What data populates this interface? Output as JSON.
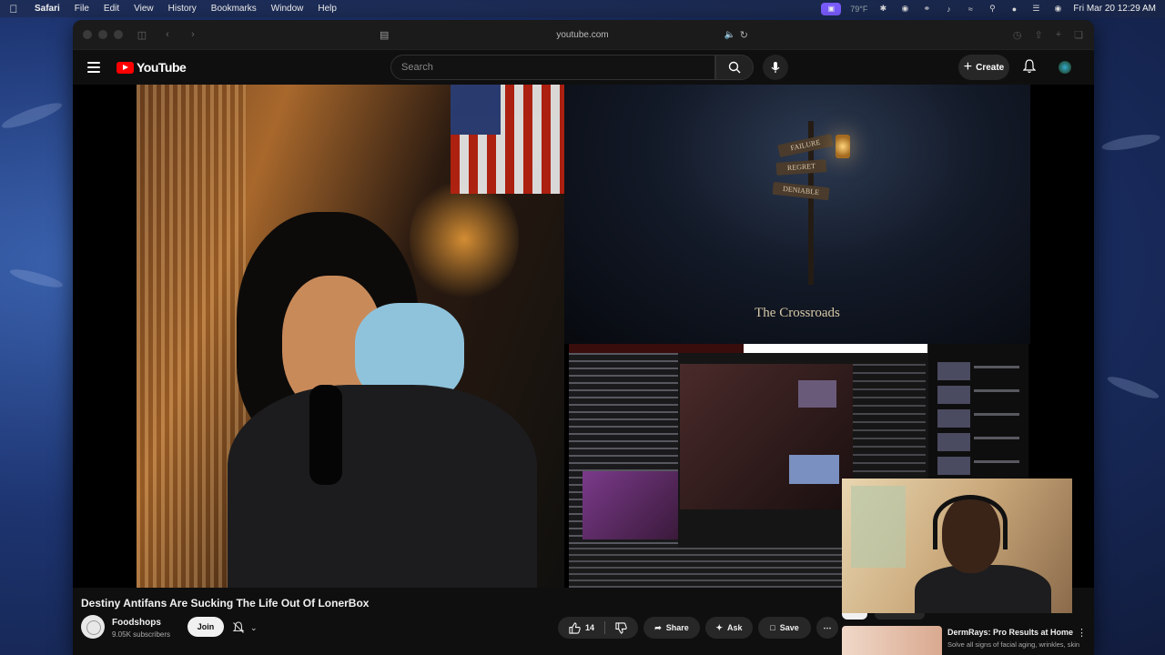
{
  "menubar": {
    "app": "Safari",
    "items": [
      "File",
      "Edit",
      "View",
      "History",
      "Bookmarks",
      "Window",
      "Help"
    ],
    "weather": "79°F",
    "datetime": "Fri Mar 20  12:29 AM"
  },
  "browser": {
    "url": "youtube.com"
  },
  "youtube": {
    "logo": "YouTube",
    "search_placeholder": "Search",
    "create_label": "Create"
  },
  "player": {
    "overlay_caption": "The Crossroads",
    "sign_words": [
      "FAILURE",
      "REGRET",
      "DENIABLE"
    ]
  },
  "video": {
    "title": "Destiny Antifans Are Sucking The Life Out Of LonerBox",
    "channel": "Foodshops",
    "subscribers": "9.05K subscribers",
    "join_label": "Join",
    "likes": "14",
    "share_label": "Share",
    "ask_label": "Ask",
    "save_label": "Save"
  },
  "chips": [
    "All",
    "From Foo"
  ],
  "ad": {
    "title": "DermRays: Pro Results at Home",
    "description": "Solve all signs of facial aging, wrinkles, skin elasticity, texture, tone"
  },
  "icons": {
    "apple": "apple-icon",
    "search": "search-icon",
    "mic": "mic-icon",
    "bell": "bell-icon",
    "like": "thumbs-up-icon",
    "dislike": "thumbs-down-icon"
  },
  "colors": {
    "yt_red": "#ff0000",
    "bg": "#0f0f0f",
    "button": "#272727"
  }
}
